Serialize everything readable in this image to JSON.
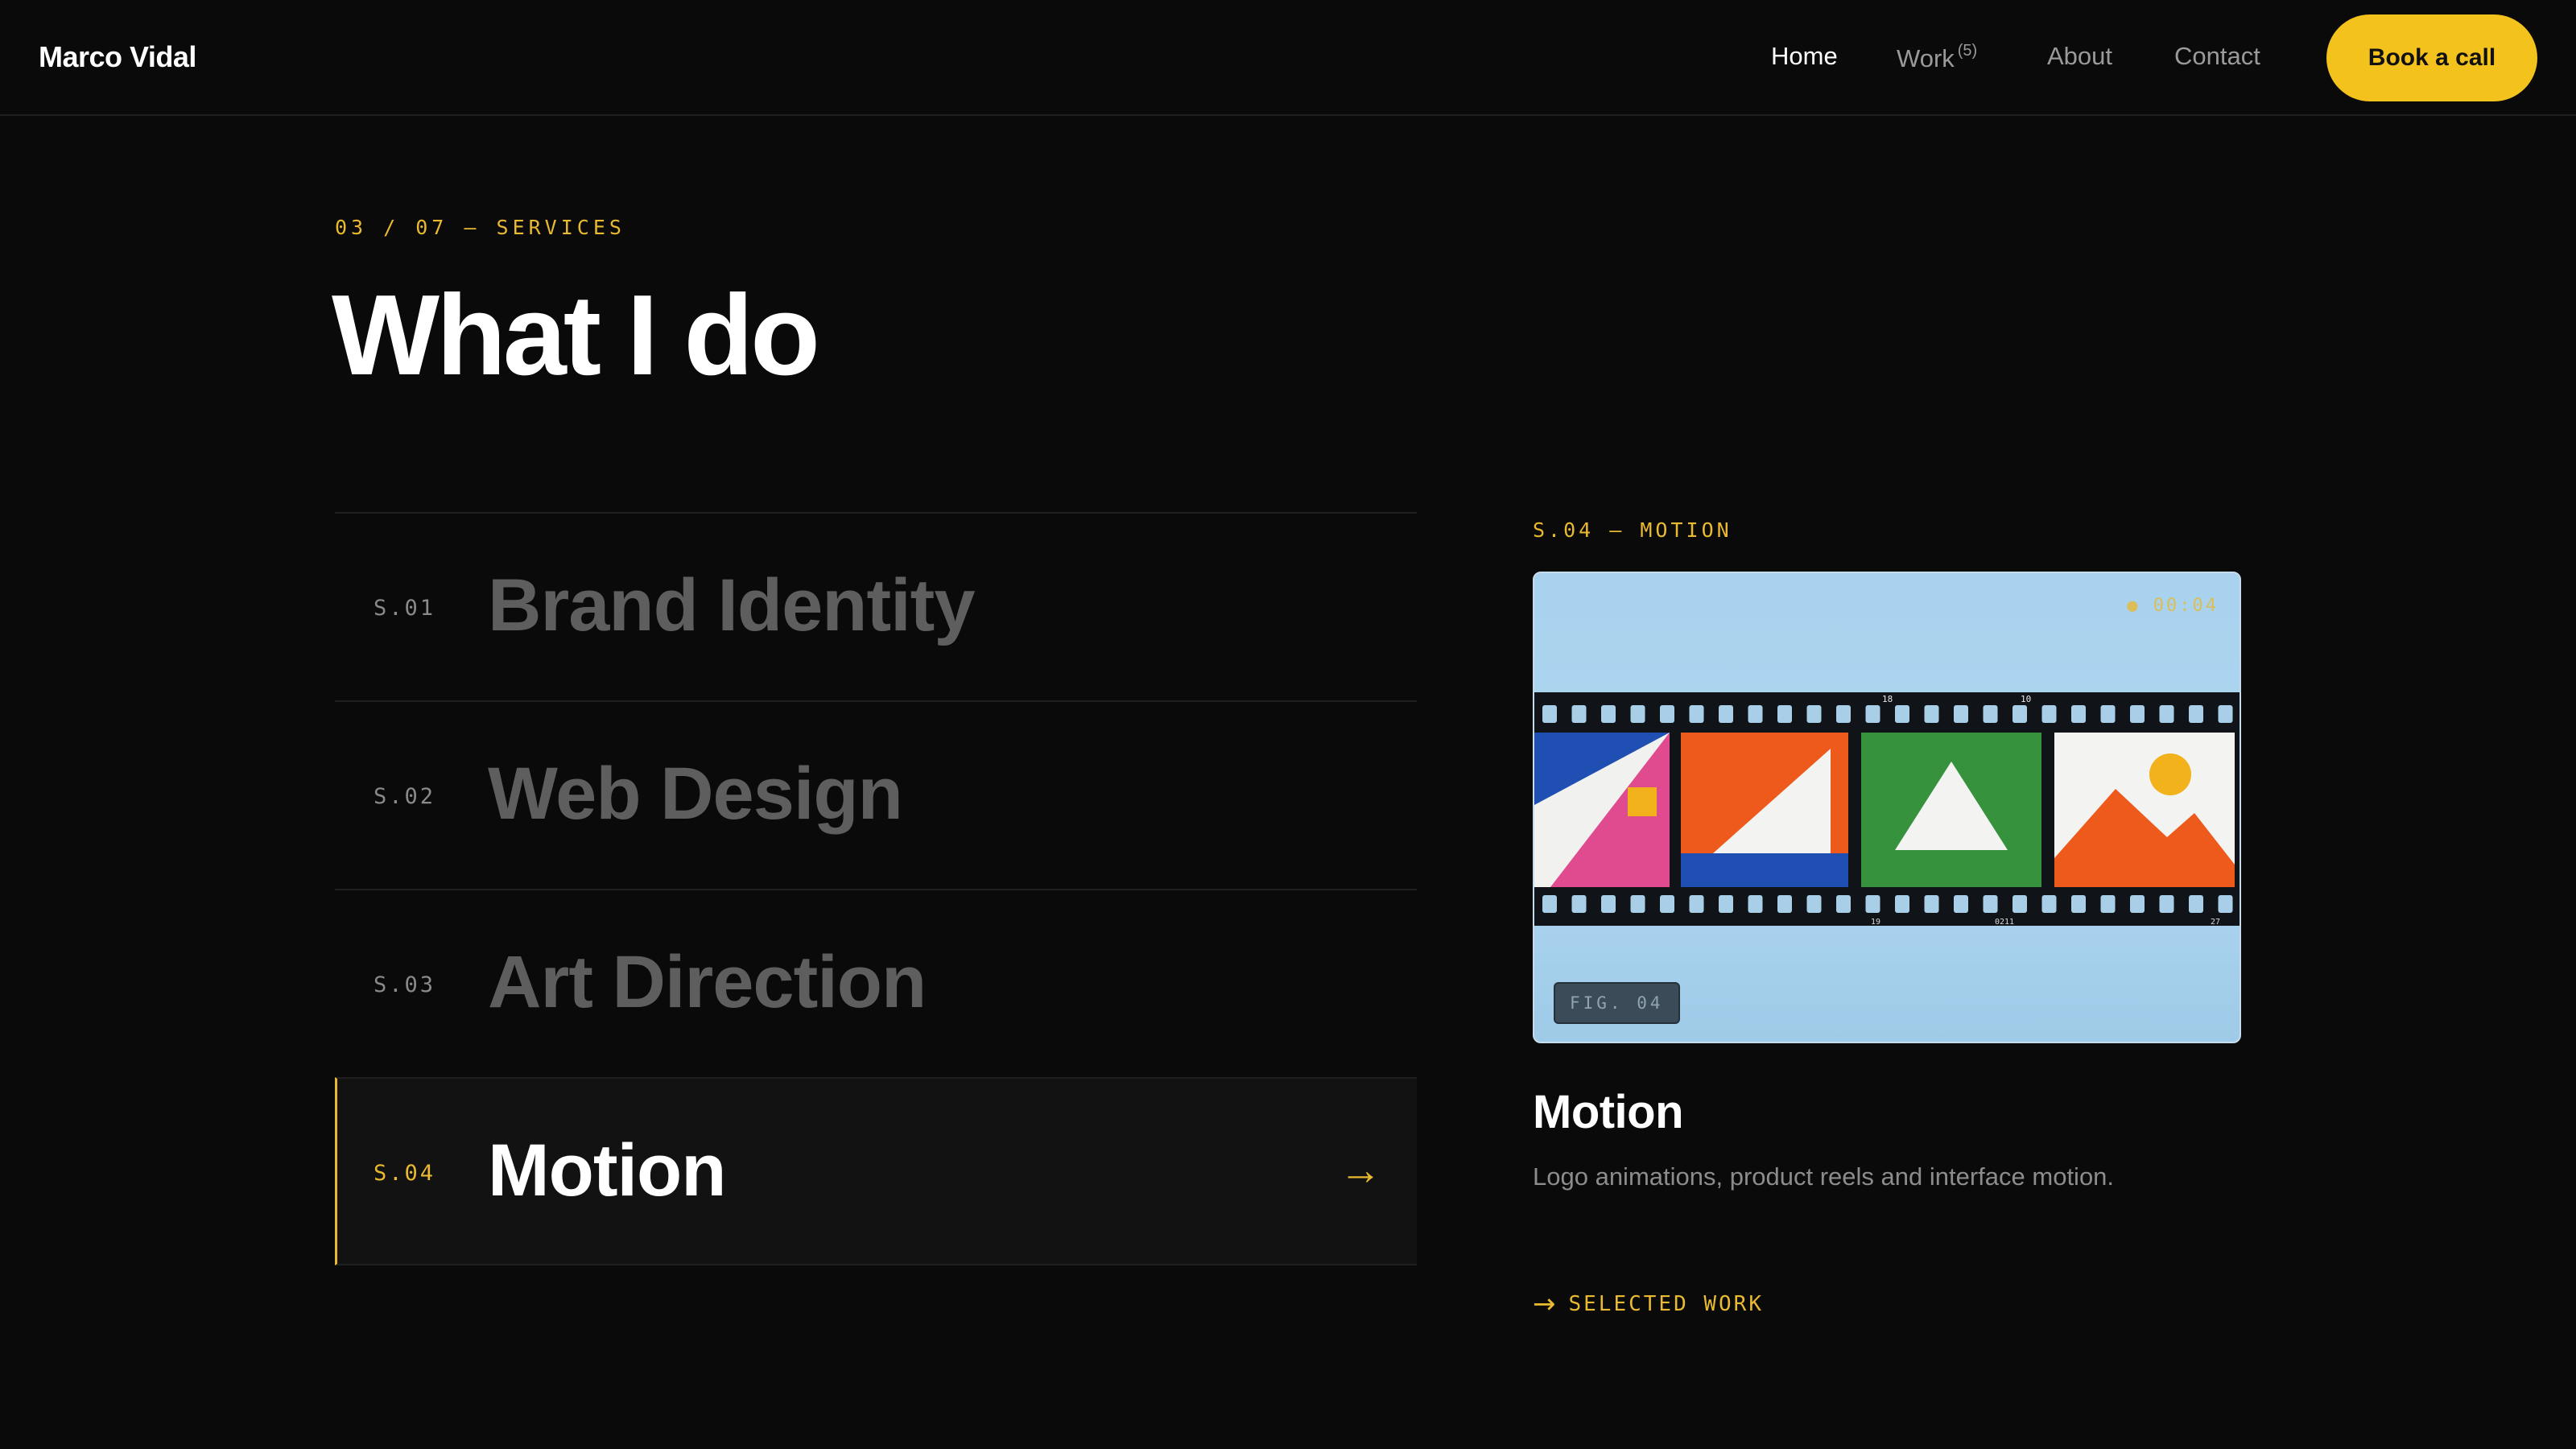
{
  "header": {
    "brand": "Marco Vidal",
    "nav": [
      {
        "label": "Home",
        "active": true
      },
      {
        "label": "Work",
        "count": "(5)",
        "active": false
      },
      {
        "label": "About",
        "active": false
      },
      {
        "label": "Contact",
        "active": false
      }
    ],
    "cta_label": "Book a call"
  },
  "section": {
    "eyebrow": "03 / 07 — SERVICES",
    "title": "What I do"
  },
  "services": [
    {
      "code": "S.01",
      "name": "Brand Identity",
      "active": false
    },
    {
      "code": "S.02",
      "name": "Web Design",
      "active": false
    },
    {
      "code": "S.03",
      "name": "Art Direction",
      "active": false
    },
    {
      "code": "S.04",
      "name": "Motion",
      "active": true,
      "arrow": "→"
    }
  ],
  "preview": {
    "label": "S.04 — MOTION",
    "timecode": "● 00:04",
    "fig_tag": "FIG. 04",
    "film_marks": [
      "18",
      "10",
      "19",
      "0211",
      "27"
    ],
    "title": "Motion",
    "description": "Logo animations, product reels and interface motion.",
    "link_arrow": "→",
    "link_label": "SELECTED WORK"
  },
  "colors": {
    "background": "#0a0a0a",
    "accent": "#f4c21d",
    "muted_text": "#5e5e5e",
    "film_sky": "#a8d2ee"
  }
}
